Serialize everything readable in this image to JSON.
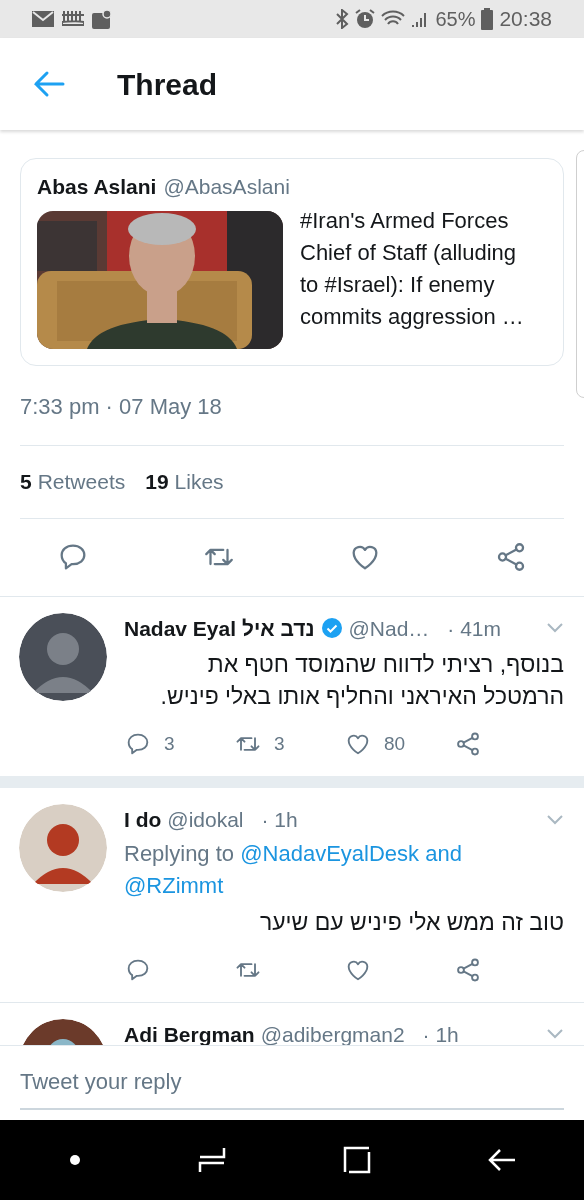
{
  "status_bar": {
    "battery": "65%",
    "time": "20:38"
  },
  "header": {
    "title": "Thread"
  },
  "quoted_tweet": {
    "name": "Abas Aslani",
    "handle": "@AbasAslani",
    "text": "#Iran's Armed Forces Chief of Staff (alluding to #Israel): If enemy commits aggression …"
  },
  "timestamp": "7:33 pm · 07 May 18",
  "stats": [
    {
      "count": "5",
      "label": "Retweets"
    },
    {
      "count": "19",
      "label": "Likes"
    }
  ],
  "actions": [
    {
      "kind": "reply"
    },
    {
      "kind": "retweet"
    },
    {
      "kind": "like"
    },
    {
      "kind": "share"
    }
  ],
  "replies": [
    {
      "name": "Nadav Eyal נדב איל",
      "verified": true,
      "handle": "@Nad…",
      "time": "· 41m",
      "text": "בנוסף, רציתי לדווח שהמוסד חטף את הרמטכל האיראני והחליף אותו באלי פיניש.",
      "actions": [
        {
          "kind": "reply",
          "count": "3"
        },
        {
          "kind": "retweet",
          "count": "3"
        },
        {
          "kind": "like",
          "count": "80"
        },
        {
          "kind": "share"
        }
      ]
    },
    {
      "name": "I do",
      "verified": false,
      "handle": "@idokal",
      "time": "· 1h",
      "replying_to": {
        "prefix": "Replying to",
        "mentions": [
          "@NadavEyalDesk",
          "@RZimmt"
        ],
        "joiner": "and"
      },
      "text": "טוב זה ממש אלי פיניש עם שיער",
      "actions": [
        {
          "kind": "reply"
        },
        {
          "kind": "retweet"
        },
        {
          "kind": "like"
        },
        {
          "kind": "share"
        }
      ]
    },
    {
      "name": "Adi Bergman",
      "verified": false,
      "handle": "@adibergman2",
      "time": "· 1h"
    }
  ],
  "reply_bar": {
    "placeholder": "Tweet your reply"
  }
}
